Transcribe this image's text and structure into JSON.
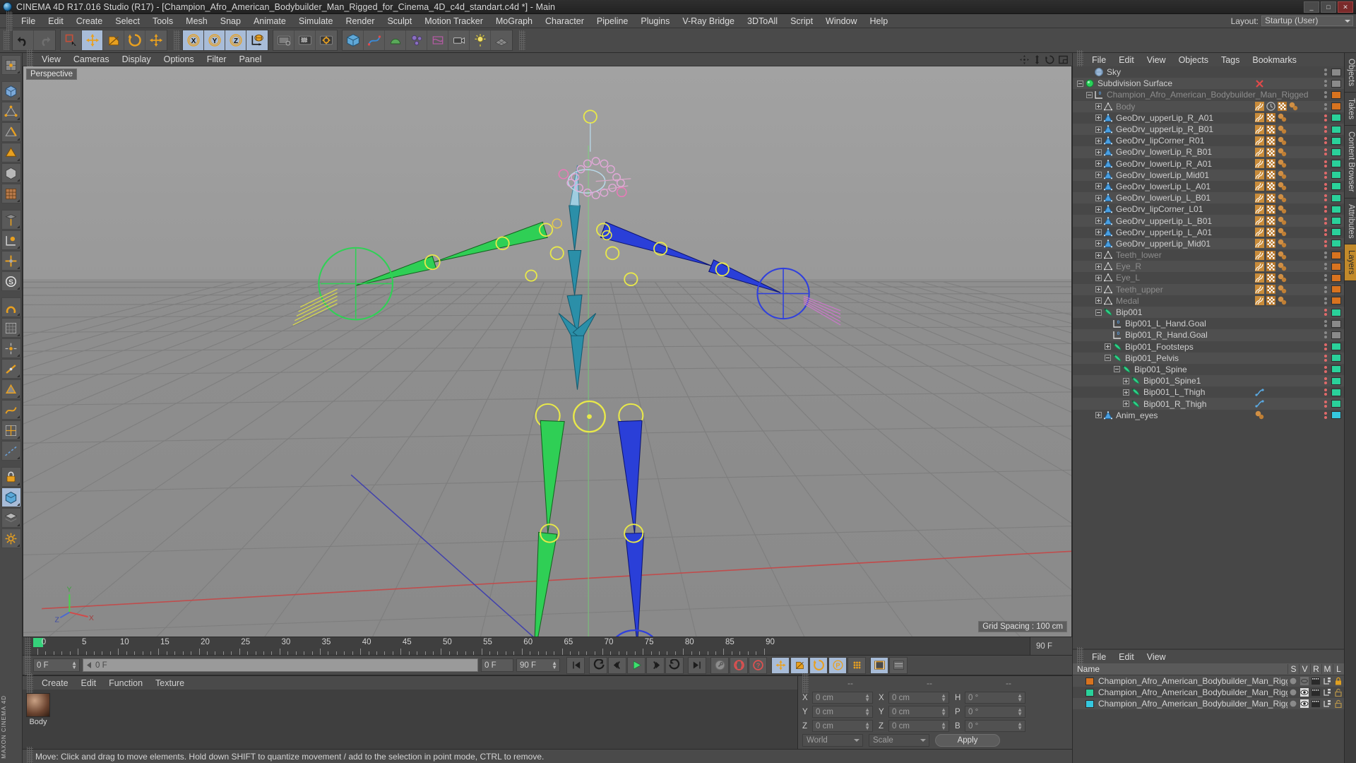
{
  "app": {
    "title": "CINEMA 4D R17.016 Studio (R17) - [Champion_Afro_American_Bodybuilder_Man_Rigged_for_Cinema_4D_c4d_standart.c4d *] - Main",
    "window_buttons": [
      "_",
      "□",
      "✕"
    ]
  },
  "menubar": {
    "items": [
      "File",
      "Edit",
      "Create",
      "Select",
      "Tools",
      "Mesh",
      "Snap",
      "Animate",
      "Simulate",
      "Render",
      "Sculpt",
      "Motion Tracker",
      "MoGraph",
      "Character",
      "Pipeline",
      "Plugins",
      "V-Ray Bridge",
      "3DToAll",
      "Script",
      "Window",
      "Help"
    ],
    "layout_label": "Layout:",
    "layout_value": "Startup (User)"
  },
  "toolbar": {
    "groups": [
      {
        "name": "history",
        "buttons": [
          {
            "icon": "undo-icon",
            "active": false
          },
          {
            "icon": "redo-icon",
            "active": false
          }
        ]
      },
      {
        "name": "selection",
        "buttons": [
          {
            "icon": "live-selection-icon",
            "active": false
          },
          {
            "icon": "move-icon",
            "active": true
          },
          {
            "icon": "scale-icon",
            "active": false
          },
          {
            "icon": "rotate-icon",
            "active": false
          },
          {
            "icon": "move-tool-icon",
            "active": false
          }
        ]
      },
      {
        "name": "axis-locks",
        "buttons": [
          {
            "icon": "x-axis-icon",
            "active": true
          },
          {
            "icon": "y-axis-icon",
            "active": true
          },
          {
            "icon": "z-axis-icon",
            "active": true
          },
          {
            "icon": "world-axis-icon",
            "active": true
          }
        ]
      },
      {
        "name": "render",
        "buttons": [
          {
            "icon": "render-view-icon",
            "active": false
          },
          {
            "icon": "render-region-icon",
            "active": false
          },
          {
            "icon": "render-settings-icon",
            "active": false
          }
        ]
      },
      {
        "name": "primitives",
        "buttons": [
          {
            "icon": "cube-icon",
            "active": false
          },
          {
            "icon": "spline-pen-icon",
            "active": false
          },
          {
            "icon": "nurbs-icon",
            "active": false
          },
          {
            "icon": "array-icon",
            "active": false
          },
          {
            "icon": "deformer-icon",
            "active": false
          },
          {
            "icon": "camera-icon",
            "active": false
          },
          {
            "icon": "light-icon",
            "active": false
          },
          {
            "icon": "floor-icon",
            "active": false
          }
        ]
      }
    ]
  },
  "leftbar": {
    "buttons": [
      {
        "icon": "texture-axis-icon",
        "active": false
      },
      {
        "icon": "object-mode-icon",
        "active": false
      },
      {
        "icon": "point-mode-icon",
        "active": false
      },
      {
        "icon": "edge-mode-icon",
        "active": false
      },
      {
        "icon": "polygon-mode-icon",
        "active": false
      },
      {
        "icon": "model-mode-icon",
        "active": false
      },
      {
        "icon": "texture-mode-icon",
        "active": false
      },
      {
        "icon": "workplane-icon",
        "active": false
      },
      {
        "icon": "axis-lock-icon",
        "active": false
      },
      {
        "icon": "enable-axis-icon",
        "active": false
      },
      {
        "icon": "viewport-solo-icon",
        "active": false
      },
      {
        "icon": "snap-icon",
        "active": false
      },
      {
        "icon": "quantize-icon",
        "active": false
      },
      {
        "icon": "point-snap-icon",
        "active": false
      },
      {
        "icon": "edge-snap-icon",
        "active": false
      },
      {
        "icon": "poly-snap-icon",
        "active": false
      },
      {
        "icon": "spline-snap-icon",
        "active": false
      },
      {
        "icon": "grid-snap-icon",
        "active": false
      },
      {
        "icon": "guide-snap-icon",
        "active": false
      },
      {
        "icon": "lock-icon",
        "active": false
      },
      {
        "icon": "selection-filter-icon",
        "active": true
      },
      {
        "icon": "layer-filter-icon",
        "active": false
      },
      {
        "icon": "settings-icon",
        "active": false
      }
    ],
    "brand": "MAXON CINEMA 4D"
  },
  "viewport": {
    "menu": [
      "View",
      "Cameras",
      "Display",
      "Options",
      "Filter",
      "Panel"
    ],
    "camera_label": "Perspective",
    "grid_label": "Grid Spacing : 100 cm",
    "header_icons": [
      "move-view-icon",
      "pan-view-icon",
      "rotate-view-icon",
      "layout-view-icon"
    ],
    "axis_labels": {
      "x": "X",
      "y": "Y",
      "z": "Z"
    }
  },
  "timeline": {
    "ticks": [
      0,
      5,
      10,
      15,
      20,
      25,
      30,
      35,
      40,
      45,
      50,
      55,
      60,
      65,
      70,
      75,
      80,
      85,
      90
    ],
    "end_field": "0 F",
    "current_frame": "0 F",
    "slider_value": "0 F",
    "range_right": "90 F",
    "preview_end": "90 F"
  },
  "playback": {
    "buttons": [
      {
        "icon": "go-to-start-icon",
        "active": false
      },
      {
        "icon": "prev-keyframe-icon",
        "active": false
      },
      {
        "icon": "step-back-icon",
        "active": false
      },
      {
        "icon": "play-icon",
        "active": false
      },
      {
        "icon": "step-forward-icon",
        "active": false
      },
      {
        "icon": "next-keyframe-icon",
        "active": false
      },
      {
        "icon": "go-to-end-icon",
        "active": false
      },
      {
        "icon": "record-active-objects-icon",
        "active": false
      },
      {
        "icon": "autokey-icon",
        "active": false
      },
      {
        "icon": "keyframe-selection-icon",
        "active": false
      },
      {
        "icon": "record-position-icon",
        "active": true
      },
      {
        "icon": "record-scale-icon",
        "active": true
      },
      {
        "icon": "record-rotation-icon",
        "active": true
      },
      {
        "icon": "record-parameter-icon",
        "active": true
      },
      {
        "icon": "record-pla-icon",
        "active": false
      },
      {
        "icon": "timeline-icon",
        "active": true
      },
      {
        "icon": "dope-sheet-icon",
        "active": false
      }
    ]
  },
  "material_manager": {
    "menu": [
      "Create",
      "Edit",
      "Function",
      "Texture"
    ],
    "materials": [
      {
        "name": "Body"
      }
    ]
  },
  "coordinates": {
    "header_dashes": [
      "--",
      "--",
      "--"
    ],
    "rows": [
      {
        "label1": "X",
        "value1": "0 cm",
        "label2": "X",
        "value2": "0 cm",
        "label3": "H",
        "value3": "0 °"
      },
      {
        "label1": "Y",
        "value1": "0 cm",
        "label2": "Y",
        "value2": "0 cm",
        "label3": "P",
        "value3": "0 °"
      },
      {
        "label1": "Z",
        "value1": "0 cm",
        "label2": "Z",
        "value2": "0 cm",
        "label3": "B",
        "value3": "0 °"
      }
    ],
    "coord_system": "World",
    "mode": "Scale",
    "apply_label": "Apply"
  },
  "statusbar": {
    "text": "Move: Click and drag to move elements. Hold down SHIFT to quantize movement / add to the selection in point mode, CTRL to remove."
  },
  "object_manager": {
    "menu": [
      "File",
      "Edit",
      "View",
      "Objects",
      "Tags",
      "Bookmarks"
    ],
    "items": [
      {
        "label": "Sky",
        "indent": 1,
        "expander": "none",
        "icon": "sky-icon",
        "dim": false,
        "swatch": "#8a8a8a",
        "tags": []
      },
      {
        "label": "Subdivision Surface",
        "indent": 0,
        "expander": "minus",
        "icon": "subdivision-icon",
        "dim": false,
        "swatch": "#8a8a8a",
        "tags": [
          "x-red"
        ]
      },
      {
        "label": "Champion_Afro_American_Bodybuilder_Man_Rigged",
        "indent": 1,
        "expander": "minus",
        "icon": "null-object-icon",
        "dim": true,
        "swatch": "#d8731f",
        "tags": []
      },
      {
        "label": "Body",
        "indent": 2,
        "expander": "plus",
        "icon": "polygon-object-icon",
        "dim": true,
        "swatch": "#d8731f",
        "tags": [
          "hair",
          "clock",
          "checker",
          "sphere"
        ]
      },
      {
        "label": "GeoDrv_upperLip_R_A01",
        "indent": 2,
        "expander": "plus",
        "icon": "poly-blue-icon",
        "dim": false,
        "swatch": "#2ad19a",
        "tags": [
          "hair",
          "checker",
          "sphere"
        ]
      },
      {
        "label": "GeoDrv_upperLip_R_B01",
        "indent": 2,
        "expander": "plus",
        "icon": "poly-blue-icon",
        "dim": false,
        "swatch": "#2ad19a",
        "tags": [
          "hair",
          "checker",
          "sphere"
        ]
      },
      {
        "label": "GeoDrv_lipCorner_R01",
        "indent": 2,
        "expander": "plus",
        "icon": "poly-blue-icon",
        "dim": false,
        "swatch": "#2ad19a",
        "tags": [
          "hair",
          "checker",
          "sphere"
        ]
      },
      {
        "label": "GeoDrv_lowerLip_R_B01",
        "indent": 2,
        "expander": "plus",
        "icon": "poly-blue-icon",
        "dim": false,
        "swatch": "#2ad19a",
        "tags": [
          "hair",
          "checker",
          "sphere"
        ]
      },
      {
        "label": "GeoDrv_lowerLip_R_A01",
        "indent": 2,
        "expander": "plus",
        "icon": "poly-blue-icon",
        "dim": false,
        "swatch": "#2ad19a",
        "tags": [
          "hair",
          "checker",
          "sphere"
        ]
      },
      {
        "label": "GeoDrv_lowerLip_Mid01",
        "indent": 2,
        "expander": "plus",
        "icon": "poly-blue-icon",
        "dim": false,
        "swatch": "#2ad19a",
        "tags": [
          "hair",
          "checker",
          "sphere"
        ]
      },
      {
        "label": "GeoDrv_lowerLip_L_A01",
        "indent": 2,
        "expander": "plus",
        "icon": "poly-blue-icon",
        "dim": false,
        "swatch": "#2ad19a",
        "tags": [
          "hair",
          "checker",
          "sphere"
        ]
      },
      {
        "label": "GeoDrv_lowerLip_L_B01",
        "indent": 2,
        "expander": "plus",
        "icon": "poly-blue-icon",
        "dim": false,
        "swatch": "#2ad19a",
        "tags": [
          "hair",
          "checker",
          "sphere"
        ]
      },
      {
        "label": "GeoDrv_lipCorner_L01",
        "indent": 2,
        "expander": "plus",
        "icon": "poly-blue-icon",
        "dim": false,
        "swatch": "#2ad19a",
        "tags": [
          "hair",
          "checker",
          "sphere"
        ]
      },
      {
        "label": "GeoDrv_upperLip_L_B01",
        "indent": 2,
        "expander": "plus",
        "icon": "poly-blue-icon",
        "dim": false,
        "swatch": "#2ad19a",
        "tags": [
          "hair",
          "checker",
          "sphere"
        ]
      },
      {
        "label": "GeoDrv_upperLip_L_A01",
        "indent": 2,
        "expander": "plus",
        "icon": "poly-blue-icon",
        "dim": false,
        "swatch": "#2ad19a",
        "tags": [
          "hair",
          "checker",
          "sphere"
        ]
      },
      {
        "label": "GeoDrv_upperLip_Mid01",
        "indent": 2,
        "expander": "plus",
        "icon": "poly-blue-icon",
        "dim": false,
        "swatch": "#2ad19a",
        "tags": [
          "hair",
          "checker",
          "sphere"
        ]
      },
      {
        "label": "Teeth_lower",
        "indent": 2,
        "expander": "plus",
        "icon": "polygon-object-icon",
        "dim": true,
        "swatch": "#d8731f",
        "tags": [
          "hair",
          "checker",
          "sphere"
        ]
      },
      {
        "label": "Eye_R",
        "indent": 2,
        "expander": "plus",
        "icon": "polygon-object-icon",
        "dim": true,
        "swatch": "#d8731f",
        "tags": [
          "hair",
          "checker",
          "sphere"
        ]
      },
      {
        "label": "Eye_L",
        "indent": 2,
        "expander": "plus",
        "icon": "polygon-object-icon",
        "dim": true,
        "swatch": "#d8731f",
        "tags": [
          "hair",
          "checker",
          "sphere"
        ]
      },
      {
        "label": "Teeth_upper",
        "indent": 2,
        "expander": "plus",
        "icon": "polygon-object-icon",
        "dim": true,
        "swatch": "#d8731f",
        "tags": [
          "hair",
          "checker",
          "sphere"
        ]
      },
      {
        "label": "Medal",
        "indent": 2,
        "expander": "plus",
        "icon": "polygon-object-icon",
        "dim": true,
        "swatch": "#d8731f",
        "tags": [
          "hair",
          "checker",
          "sphere"
        ]
      },
      {
        "label": "Bip001",
        "indent": 2,
        "expander": "minus",
        "icon": "joint-icon",
        "dim": false,
        "swatch": "#2ad19a",
        "tags": []
      },
      {
        "label": "Bip001_L_Hand.Goal",
        "indent": 3,
        "expander": "none",
        "icon": "null-object-icon",
        "dim": false,
        "swatch": "#8a8a8a",
        "tags": []
      },
      {
        "label": "Bip001_R_Hand.Goal",
        "indent": 3,
        "expander": "none",
        "icon": "null-object-icon",
        "dim": false,
        "swatch": "#8a8a8a",
        "tags": []
      },
      {
        "label": "Bip001_Footsteps",
        "indent": 3,
        "expander": "plus",
        "icon": "joint-icon",
        "dim": false,
        "swatch": "#2ad19a",
        "tags": []
      },
      {
        "label": "Bip001_Pelvis",
        "indent": 3,
        "expander": "minus",
        "icon": "joint-icon",
        "dim": false,
        "swatch": "#2ad19a",
        "tags": []
      },
      {
        "label": "Bip001_Spine",
        "indent": 4,
        "expander": "minus",
        "icon": "joint-icon",
        "dim": false,
        "swatch": "#2ad19a",
        "tags": []
      },
      {
        "label": "Bip001_Spine1",
        "indent": 5,
        "expander": "plus",
        "icon": "joint-icon",
        "dim": false,
        "swatch": "#2ad19a",
        "tags": []
      },
      {
        "label": "Bip001_L_Thigh",
        "indent": 5,
        "expander": "plus",
        "icon": "joint-icon",
        "dim": false,
        "swatch": "#2ad19a",
        "tags": [
          "ik"
        ]
      },
      {
        "label": "Bip001_R_Thigh",
        "indent": 5,
        "expander": "plus",
        "icon": "joint-icon",
        "dim": false,
        "swatch": "#2ad19a",
        "tags": [
          "ik"
        ]
      },
      {
        "label": "Anim_eyes",
        "indent": 2,
        "expander": "plus",
        "icon": "poly-blue-icon",
        "dim": false,
        "swatch": "#35c8e0",
        "tags": [
          "sphere"
        ]
      }
    ]
  },
  "layer_manager": {
    "menu": [
      "File",
      "Edit",
      "View"
    ],
    "columns": [
      "Name",
      "S",
      "V",
      "R",
      "M",
      "L"
    ],
    "rows": [
      {
        "color": "#d8731f",
        "name": "Champion_Afro_American_Bodybuilder_Man_Rigged_Geometry",
        "s": "off",
        "v": "off",
        "r": "on",
        "m": "on",
        "l": "locked"
      },
      {
        "color": "#2ad19a",
        "name": "Champion_Afro_American_Bodybuilder_Man_Rigged_Bones",
        "s": "off",
        "v": "on",
        "r": "on",
        "m": "on",
        "l": "unlocked"
      },
      {
        "color": "#35c8e0",
        "name": "Champion_Afro_American_Bodybuilder_Man_Rigged_Helpers",
        "s": "off",
        "v": "on",
        "r": "on",
        "m": "on",
        "l": "unlocked"
      }
    ]
  },
  "right_tabs": [
    {
      "label": "Objects",
      "active": false
    },
    {
      "label": "Takes",
      "active": false
    },
    {
      "label": "Content Browser",
      "active": false
    },
    {
      "label": "Attributes",
      "active": false
    },
    {
      "label": "Layers",
      "active": true
    }
  ],
  "scene": {
    "description": "3D viewport showing a rigged humanoid character skeleton with green (left) and blue (right) IK joint chains, yellow circular controllers, and a ground grid plane.",
    "bone_color_left": "#2fcf55",
    "bone_color_right": "#2a3fd8",
    "controller_color": "#e8e84a",
    "spine_color": "#2b8fa8",
    "grid_color": "#8d8d8d"
  }
}
